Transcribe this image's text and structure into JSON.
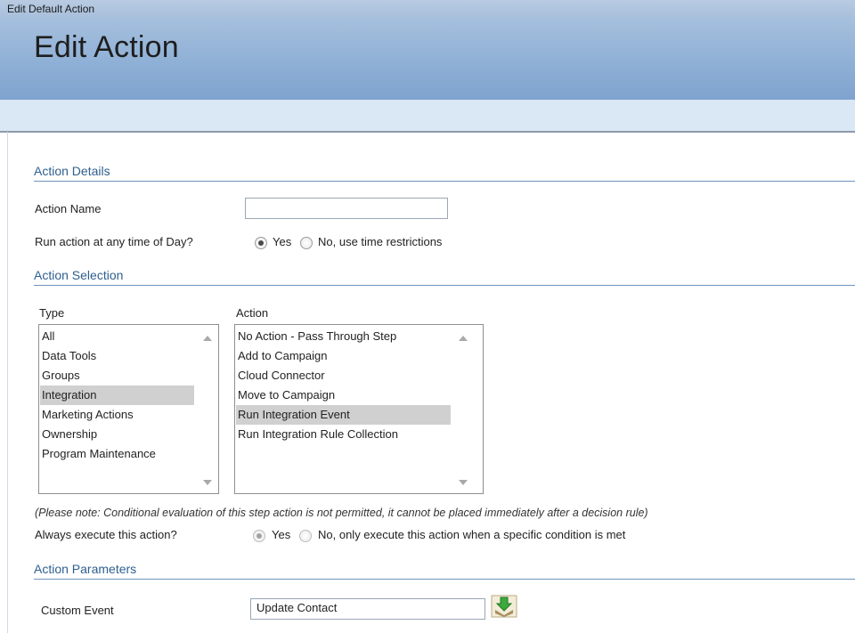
{
  "window": {
    "title": "Edit Default Action"
  },
  "header": {
    "title": "Edit Action"
  },
  "action_details": {
    "heading": "Action Details",
    "name_label": "Action Name",
    "name_value": "",
    "run_time_label": "Run action at any time of Day?",
    "run_time_options": [
      "Yes",
      "No, use time restrictions"
    ],
    "run_time_selected": "Yes"
  },
  "action_selection": {
    "heading": "Action Selection",
    "type_label": "Type",
    "type_items": [
      "All",
      "Data Tools",
      "Groups",
      "Integration",
      "Marketing Actions",
      "Ownership",
      "Program Maintenance"
    ],
    "type_selected": "Integration",
    "action_label": "Action",
    "action_items": [
      "No Action - Pass Through Step",
      "Add to Campaign",
      "Cloud Connector",
      "Move to Campaign",
      "Run Integration Event",
      "Run Integration Rule Collection"
    ],
    "action_selected": "Run Integration Event",
    "note": "(Please note: Conditional evaluation of this step action is not permitted, it cannot be placed immediately after a decision rule)",
    "always_label": "Always execute this action?",
    "always_options": [
      "Yes",
      "No, only execute this action when a specific condition is met"
    ],
    "always_selected": "Yes"
  },
  "action_parameters": {
    "heading": "Action Parameters",
    "custom_event_label": "Custom Event",
    "custom_event_value": "Update Contact",
    "picker_icon": "download-picker-icon"
  }
}
